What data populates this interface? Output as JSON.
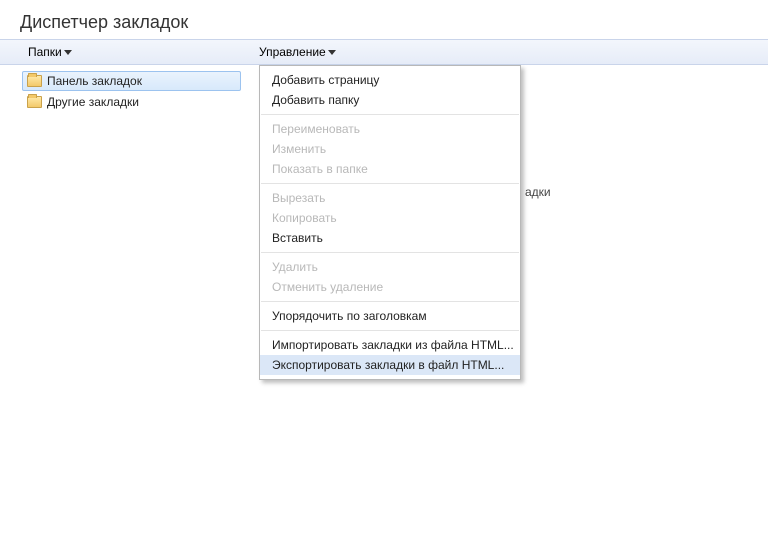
{
  "title": "Диспетчер закладок",
  "toolbar": {
    "folders_label": "Папки",
    "manage_label": "Управление"
  },
  "sidebar": {
    "items": [
      {
        "label": "Панель закладок",
        "selected": true
      },
      {
        "label": "Другие закладки",
        "selected": false
      }
    ]
  },
  "behind_menu_text_fragment": "адки",
  "menu": {
    "items": [
      {
        "label": "Добавить страницу",
        "disabled": false
      },
      {
        "label": "Добавить папку",
        "disabled": false
      },
      {
        "sep": true
      },
      {
        "label": "Переименовать",
        "disabled": true
      },
      {
        "label": "Изменить",
        "disabled": true
      },
      {
        "label": "Показать в папке",
        "disabled": true
      },
      {
        "sep": true
      },
      {
        "label": "Вырезать",
        "disabled": true
      },
      {
        "label": "Копировать",
        "disabled": true
      },
      {
        "label": "Вставить",
        "disabled": false
      },
      {
        "sep": true
      },
      {
        "label": "Удалить",
        "disabled": true
      },
      {
        "label": "Отменить удаление",
        "disabled": true
      },
      {
        "sep": true
      },
      {
        "label": "Упорядочить по заголовкам",
        "disabled": false
      },
      {
        "sep": true
      },
      {
        "label": "Импортировать закладки из файла HTML...",
        "disabled": false
      },
      {
        "label": "Экспортировать закладки в файл HTML...",
        "disabled": false,
        "highlight": true
      }
    ]
  }
}
